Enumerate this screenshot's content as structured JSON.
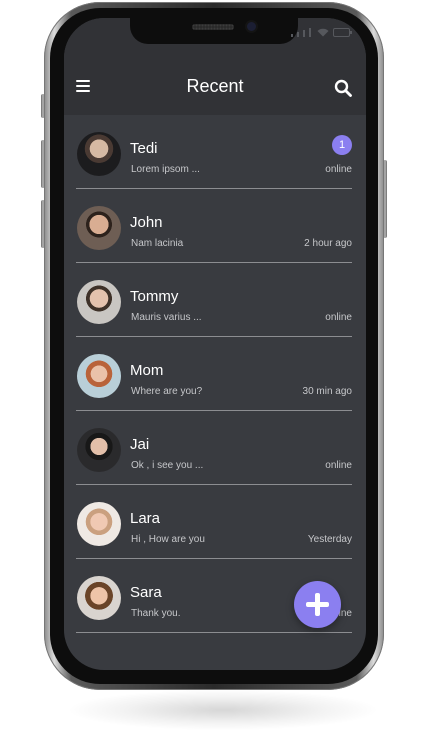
{
  "header": {
    "title": "Recent",
    "menu_icon": "hamburger-menu-icon",
    "search_icon": "search-icon"
  },
  "colors": {
    "background": "#393b40",
    "header": "#313236",
    "accent": "#8b7ff0",
    "text": "#ffffff",
    "subtext": "#c6c7ca"
  },
  "conversations": [
    {
      "name": "Tedi",
      "message": "Lorem ipsom ...",
      "status": "online",
      "unread": "1"
    },
    {
      "name": "John",
      "message": "Nam lacinia",
      "status": "2 hour ago"
    },
    {
      "name": "Tommy",
      "message": "Mauris varius ...",
      "status": "online"
    },
    {
      "name": "Mom",
      "message": "Where are you?",
      "status": "30 min ago"
    },
    {
      "name": "Jai",
      "message": "Ok , i see you ...",
      "status": "online"
    },
    {
      "name": "Lara",
      "message": "Hi , How are you",
      "status": "Yesterday"
    },
    {
      "name": "Sara",
      "message": "Thank you.",
      "status": "online"
    }
  ],
  "fab": {
    "icon": "plus-icon"
  }
}
